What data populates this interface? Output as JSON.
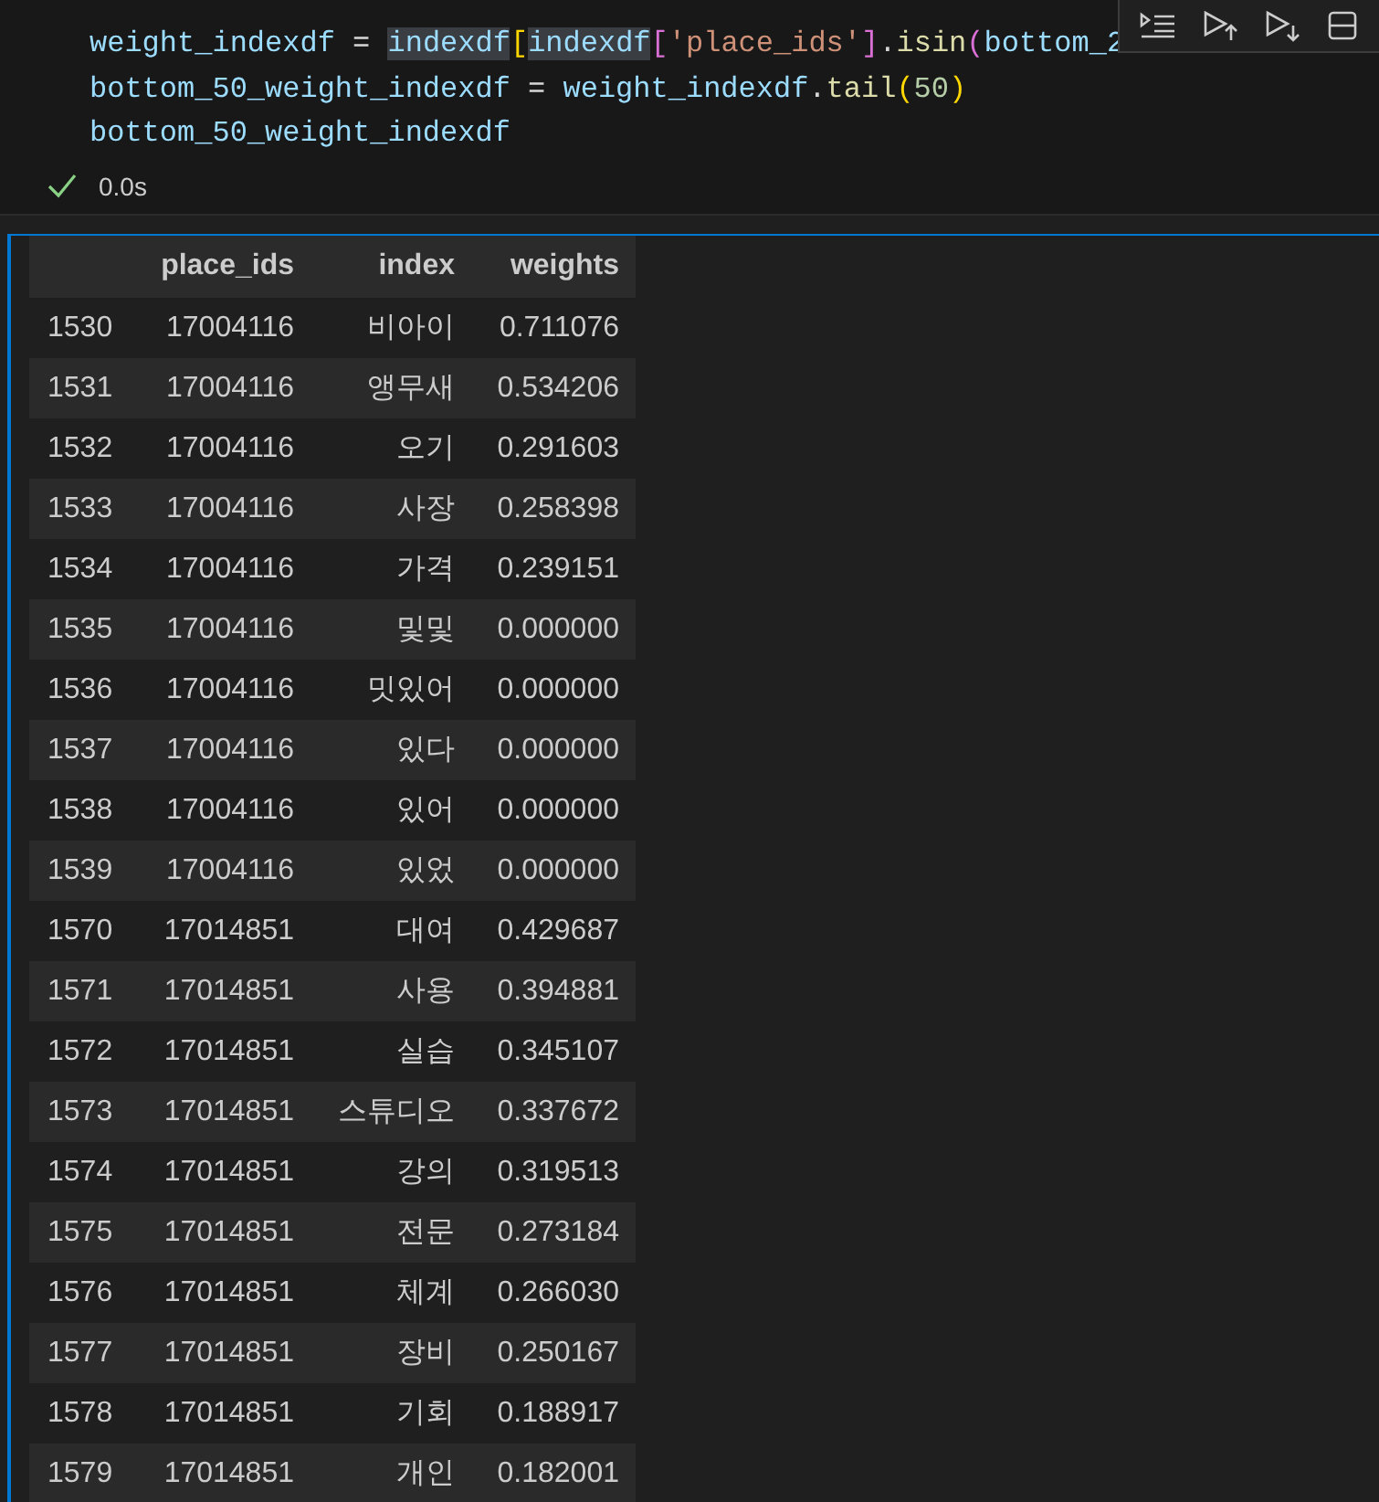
{
  "code_cell": {
    "lines": [
      [
        {
          "kind": "var",
          "text": "weight_indexdf"
        },
        {
          "kind": "op",
          "text": " = "
        },
        {
          "kind": "match",
          "text": "indexdf"
        },
        {
          "kind": "bracket1",
          "text": "["
        },
        {
          "kind": "match",
          "text": "indexdf"
        },
        {
          "kind": "bracket2",
          "text": "["
        },
        {
          "kind": "str",
          "text": "'place_ids'"
        },
        {
          "kind": "bracket2",
          "text": "]"
        },
        {
          "kind": "op",
          "text": "."
        },
        {
          "kind": "fn",
          "text": "isin"
        },
        {
          "kind": "bracket2",
          "text": "("
        },
        {
          "kind": "var",
          "text": "bottom_2"
        }
      ],
      [
        {
          "kind": "var",
          "text": "bottom_50_weight_indexdf"
        },
        {
          "kind": "op",
          "text": " = "
        },
        {
          "kind": "var",
          "text": "weight_indexdf"
        },
        {
          "kind": "op",
          "text": "."
        },
        {
          "kind": "fn",
          "text": "tail"
        },
        {
          "kind": "bracket1",
          "text": "("
        },
        {
          "kind": "num",
          "text": "50"
        },
        {
          "kind": "bracket1",
          "text": ")"
        }
      ],
      [
        {
          "kind": "var",
          "text": "bottom_50_weight_indexdf"
        }
      ]
    ],
    "status": {
      "succeeded": true,
      "time": "0.0s"
    }
  },
  "table": {
    "columns": [
      "",
      "place_ids",
      "index",
      "weights"
    ],
    "rows": [
      [
        "1530",
        "17004116",
        "비아이",
        "0.711076"
      ],
      [
        "1531",
        "17004116",
        "앵무새",
        "0.534206"
      ],
      [
        "1532",
        "17004116",
        "오기",
        "0.291603"
      ],
      [
        "1533",
        "17004116",
        "사장",
        "0.258398"
      ],
      [
        "1534",
        "17004116",
        "가격",
        "0.239151"
      ],
      [
        "1535",
        "17004116",
        "및및",
        "0.000000"
      ],
      [
        "1536",
        "17004116",
        "밋있어",
        "0.000000"
      ],
      [
        "1537",
        "17004116",
        "있다",
        "0.000000"
      ],
      [
        "1538",
        "17004116",
        "있어",
        "0.000000"
      ],
      [
        "1539",
        "17004116",
        "있었",
        "0.000000"
      ],
      [
        "1570",
        "17014851",
        "대여",
        "0.429687"
      ],
      [
        "1571",
        "17014851",
        "사용",
        "0.394881"
      ],
      [
        "1572",
        "17014851",
        "실습",
        "0.345107"
      ],
      [
        "1573",
        "17014851",
        "스튜디오",
        "0.337672"
      ],
      [
        "1574",
        "17014851",
        "강의",
        "0.319513"
      ],
      [
        "1575",
        "17014851",
        "전문",
        "0.273184"
      ],
      [
        "1576",
        "17014851",
        "체계",
        "0.266030"
      ],
      [
        "1577",
        "17014851",
        "장비",
        "0.250167"
      ],
      [
        "1578",
        "17014851",
        "기회",
        "0.188917"
      ],
      [
        "1579",
        "17014851",
        "개인",
        "0.182001"
      ]
    ]
  }
}
